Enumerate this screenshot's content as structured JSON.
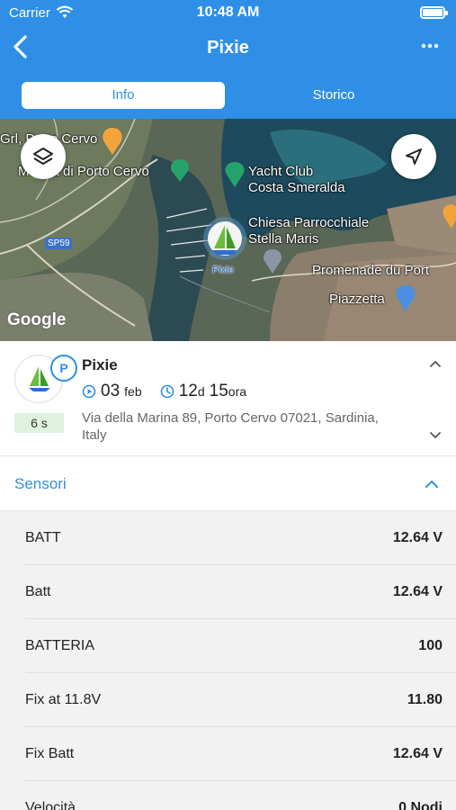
{
  "status_bar": {
    "carrier": "Carrier",
    "time": "10:48 AM"
  },
  "nav": {
    "title": "Pixie"
  },
  "tabs": [
    {
      "label": "Info",
      "active": true
    },
    {
      "label": "Storico",
      "active": false
    }
  ],
  "map": {
    "labels": {
      "grl_porto_cervo": "Grl, Porto Cervo",
      "marina_porto_cervo": "Marina di Porto Cervo",
      "yacht_club": "Yacht Club",
      "costa_smeralda": "Costa Smeralda",
      "chiesa": "Chiesa Parrocchiale",
      "stella_maris": "Stella Maris",
      "promenade": "Promenade du Port",
      "piazzetta": "Piazzetta",
      "road": "SP59",
      "marker_name": "Pixie"
    },
    "attribution": "Google"
  },
  "vessel": {
    "name": "Pixie",
    "badge": "P",
    "age": "6 s",
    "date_day": "03",
    "date_month": "feb",
    "duration_days": "12",
    "duration_days_unit": "d",
    "duration_hours": "15",
    "duration_hours_unit": "ora",
    "address": "Via della Marina 89, Porto Cervo 07021, Sardinia, Italy"
  },
  "sensors": {
    "title": "Sensori",
    "rows": [
      {
        "label": "BATT",
        "value": "12.64 V"
      },
      {
        "label": "Batt",
        "value": "12.64 V"
      },
      {
        "label": "BATTERIA",
        "value": "100"
      },
      {
        "label": "Fix at 11.8V",
        "value": "11.80"
      },
      {
        "label": "Fix Batt",
        "value": "12.64 V"
      },
      {
        "label": "Velocità",
        "value": "0 Nodi"
      }
    ]
  },
  "colors": {
    "accent": "#2f8fe6",
    "age_badge": "#dff1df"
  },
  "icons": [
    "wifi-icon",
    "battery-icon",
    "back-chevron-icon",
    "more-dots-icon",
    "layers-icon",
    "locate-arrow-icon",
    "play-circle-icon",
    "clock-icon",
    "chevron-up-icon",
    "chevron-down-icon",
    "sailboat-icon"
  ]
}
